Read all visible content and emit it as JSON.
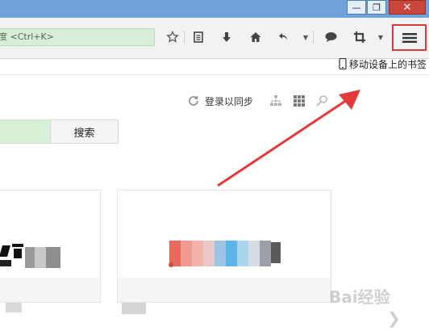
{
  "window": {
    "minimize_glyph": "—",
    "restore_glyph": "❐",
    "close_glyph": "✕"
  },
  "toolbar": {
    "url_placeholder": "度 <Ctrl+K>",
    "icons": [
      "star-icon",
      "bookmarks-list-icon",
      "download-icon",
      "home-icon",
      "undo-icon",
      "chat-icon",
      "crop-icon",
      "menu-icon"
    ],
    "mobile_bookmarks_label": "移动设备上的书签"
  },
  "page": {
    "sync_label": "登录以同步",
    "search_button": "搜索"
  },
  "watermark": "Bai经验",
  "colors": {
    "accent_red": "#d63b3b",
    "titlebar": "#6fa2d6",
    "search_green": "#d7eed7"
  }
}
